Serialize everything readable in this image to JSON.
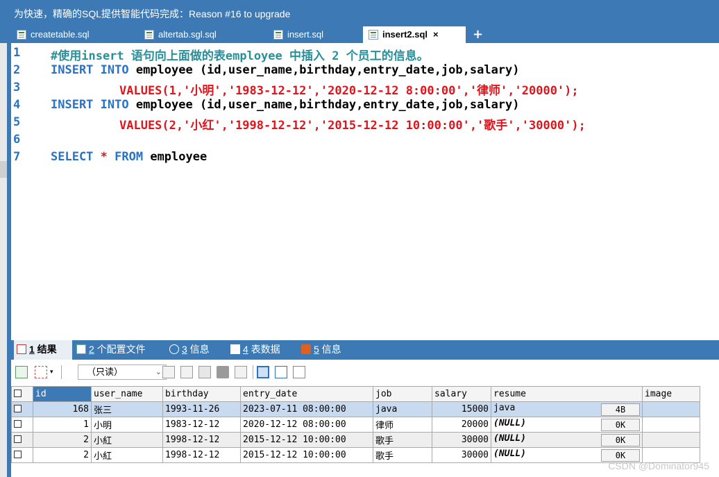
{
  "banner": {
    "text": "为快速，精确的SQL提供智能代码完成：Reason #16 to upgrade"
  },
  "tabs": [
    {
      "label": "createtable.sql"
    },
    {
      "label": "altertab.sgl.sql"
    },
    {
      "label": "insert.sql"
    },
    {
      "label": "insert2.sql"
    }
  ],
  "tab_close": "×",
  "tab_add": "+",
  "editor": {
    "line_numbers": [
      "1",
      "2",
      "3",
      "4",
      "5",
      "6",
      "7"
    ],
    "comment": "#使用insert 语句向上面做的表employee 中插入 2 个员工的信息。",
    "insert_kw": "INSERT INTO",
    "insert_rest": " employee (id,user_name,birthday,entry_date,job,salary)",
    "values_kw": "VALUES",
    "values1": "(1,'小明','1983-12-12','2020-12-12 8:00:00','律师','20000');",
    "values2": "(2,'小红','1998-12-12','2015-12-12 10:00:00','歌手','30000');",
    "select_kw": "SELECT",
    "select_star": " * ",
    "from_kw": "FROM",
    "select_table": " employee"
  },
  "result_tabs": [
    {
      "num": "1",
      "label": " 结果"
    },
    {
      "num": "2",
      "label": " 个配置文件"
    },
    {
      "num": "3",
      "label": " 信息"
    },
    {
      "num": "4",
      "label": " 表数据"
    },
    {
      "num": "5",
      "label": " 信息"
    }
  ],
  "toolbar": {
    "mode": "（只读）",
    "chevron": "⌄"
  },
  "grid": {
    "columns": [
      "id",
      "user_name",
      "birthday",
      "entry_date",
      "job",
      "salary",
      "resume",
      "image"
    ],
    "rows": [
      {
        "id": "168",
        "user_name": "张三",
        "birthday": "1993-11-26",
        "entry_date": "2023-07-11 08:00:00",
        "job": "java",
        "salary": "15000",
        "resume": "java",
        "size": "4B"
      },
      {
        "id": "1",
        "user_name": "小明",
        "birthday": "1983-12-12",
        "entry_date": "2020-12-12 08:00:00",
        "job": "律师",
        "salary": "20000",
        "resume": "(NULL)",
        "size": "0K"
      },
      {
        "id": "2",
        "user_name": "小紅",
        "birthday": "1998-12-12",
        "entry_date": "2015-12-12 10:00:00",
        "job": "歌手",
        "salary": "30000",
        "resume": "(NULL)",
        "size": "0K"
      },
      {
        "id": "2",
        "user_name": "小紅",
        "birthday": "1998-12-12",
        "entry_date": "2015-12-12 10:00:00",
        "job": "歌手",
        "salary": "30000",
        "resume": "(NULL)",
        "size": "0K"
      }
    ]
  },
  "watermark": "CSDN @Dominator945",
  "colors": {
    "accent": "#3d7ab5",
    "keyword": "#2a72c4",
    "string": "#e0141b",
    "comment": "#27909a",
    "selected_row": "#c8daf0"
  }
}
